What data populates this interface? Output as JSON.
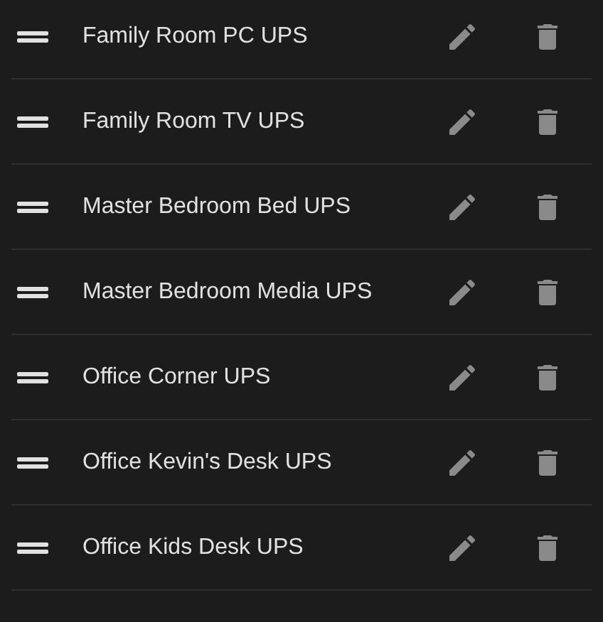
{
  "items": [
    {
      "name": "Family Room PC UPS"
    },
    {
      "name": "Family Room TV UPS"
    },
    {
      "name": "Master Bedroom Bed UPS"
    },
    {
      "name": "Master Bedroom Media UPS"
    },
    {
      "name": "Office Corner UPS"
    },
    {
      "name": "Office Kevin's Desk UPS"
    },
    {
      "name": "Office Kids Desk UPS"
    }
  ]
}
